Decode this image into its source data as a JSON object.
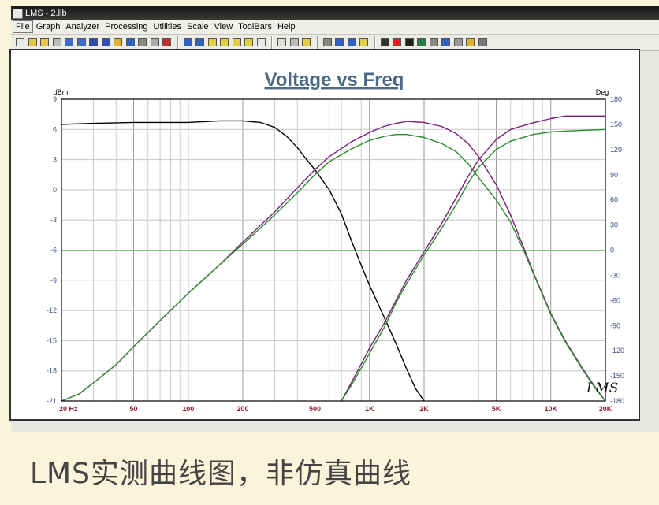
{
  "window": {
    "title": "LMS - 2.lib"
  },
  "menu": [
    "File",
    "Graph",
    "Analyzer",
    "Processing",
    "Utilities",
    "Scale",
    "View",
    "ToolBars",
    "Help"
  ],
  "toolbar": {
    "icons": [
      {
        "name": "new-icon",
        "color": "#e8e8e8"
      },
      {
        "name": "open-icon",
        "color": "#e8c54a"
      },
      {
        "name": "open-folder-icon",
        "color": "#e8c54a"
      },
      {
        "name": "save-gray-icon",
        "color": "#bbbbbb"
      },
      {
        "name": "save-icon",
        "color": "#3a6fd0"
      },
      {
        "name": "import-icon",
        "color": "#3a6fd0"
      },
      {
        "name": "export-icon",
        "color": "#2e4fb0"
      },
      {
        "name": "library-icon",
        "color": "#2e4fb0"
      },
      {
        "name": "folder-icon",
        "color": "#e0b030"
      },
      {
        "name": "disk-icon",
        "color": "#3060c0"
      },
      {
        "name": "print-icon",
        "color": "#888888"
      },
      {
        "name": "edit-icon",
        "color": "#aaaaaa"
      },
      {
        "name": "clear-icon",
        "color": "#c03030"
      },
      {
        "name": "zoom-in-icon",
        "color": "#3060c0"
      },
      {
        "name": "zoom-out-icon",
        "color": "#3060c0"
      },
      {
        "name": "graph-a-icon",
        "color": "#e0d040"
      },
      {
        "name": "graph-b-icon",
        "color": "#e0d040"
      },
      {
        "name": "graph-c-icon",
        "color": "#e0d040"
      },
      {
        "name": "graph-d-icon",
        "color": "#e0d040"
      },
      {
        "name": "grid-icon",
        "color": "#e8e8e8"
      },
      {
        "name": "window-icon",
        "color": "#dddddd"
      },
      {
        "name": "panel-icon",
        "color": "#bbbbbb"
      },
      {
        "name": "help-icon",
        "color": "#e0d040"
      },
      {
        "name": "cursor-icon",
        "color": "#888888"
      },
      {
        "name": "marker-a-icon",
        "color": "#3060c0"
      },
      {
        "name": "marker-b-icon",
        "color": "#3060c0"
      },
      {
        "name": "marker-c-icon",
        "color": "#e0d040"
      },
      {
        "name": "chip-icon",
        "color": "#333333"
      },
      {
        "name": "record-icon",
        "color": "#e02020"
      },
      {
        "name": "stop-icon",
        "color": "#222222"
      },
      {
        "name": "meter-icon",
        "color": "#208040"
      },
      {
        "name": "probe-icon",
        "color": "#888888"
      },
      {
        "name": "wand-icon",
        "color": "#3060c0"
      },
      {
        "name": "tweezers-icon",
        "color": "#999999"
      },
      {
        "name": "gear-icon",
        "color": "#e0b030"
      },
      {
        "name": "speaker-icon",
        "color": "#777777"
      }
    ]
  },
  "chart_data": {
    "type": "line",
    "title": "Voltage vs Freq",
    "x_scale": "log",
    "xlim": [
      20,
      20000
    ],
    "x_ticks": [
      {
        "value": 20,
        "label": "20  Hz"
      },
      {
        "value": 50,
        "label": "50"
      },
      {
        "value": 100,
        "label": "100"
      },
      {
        "value": 200,
        "label": "200"
      },
      {
        "value": 500,
        "label": "500"
      },
      {
        "value": 1000,
        "label": "1K"
      },
      {
        "value": 2000,
        "label": "2K"
      },
      {
        "value": 5000,
        "label": "5K"
      },
      {
        "value": 10000,
        "label": "10K"
      },
      {
        "value": 20000,
        "label": "20K"
      }
    ],
    "y_left": {
      "unit": "dBm",
      "ylim": [
        -21,
        9
      ],
      "ticks": [
        9,
        6,
        3,
        0,
        -3,
        -6,
        -9,
        -12,
        -15,
        -18,
        -21
      ]
    },
    "y_right": {
      "unit": "Deg",
      "ylim": [
        -180,
        180
      ],
      "ticks": [
        180,
        150,
        120,
        90,
        60,
        30,
        0,
        -30,
        -60,
        -90,
        -120,
        -150,
        -180
      ]
    },
    "reference_line": {
      "axis": "left",
      "value": -6,
      "color": "#7ec77e"
    },
    "grid": true,
    "series": [
      {
        "axis": "left",
        "color": "#000000",
        "x": [
          20,
          30,
          50,
          100,
          150,
          200,
          250,
          300,
          350,
          400,
          450,
          500,
          600,
          700,
          800,
          900,
          1000,
          1200,
          1400,
          1600,
          1800,
          2000
        ],
        "y": [
          6.5,
          6.6,
          6.7,
          6.7,
          6.85,
          6.85,
          6.7,
          6.2,
          5.3,
          4.2,
          3.0,
          2.0,
          0.0,
          -2.4,
          -5.2,
          -7.5,
          -9.5,
          -12.6,
          -15.3,
          -17.8,
          -19.8,
          -21
        ]
      },
      {
        "axis": "left",
        "color": "#7a1f7a",
        "x": [
          20,
          25,
          30,
          40,
          50,
          70,
          100,
          150,
          200,
          300,
          400,
          500,
          600,
          800,
          1000,
          1200,
          1400,
          1600,
          2000,
          2500,
          3000,
          3500,
          4000,
          5000,
          6000,
          7000,
          8000,
          10000,
          12000,
          15000,
          18000,
          20000
        ],
        "y": [
          -21,
          -20.3,
          -19.2,
          -17.4,
          -15.6,
          -13.0,
          -10.3,
          -7.4,
          -5.2,
          -2.2,
          0.2,
          2.0,
          3.3,
          4.8,
          5.7,
          6.3,
          6.6,
          6.8,
          6.7,
          6.3,
          5.6,
          4.6,
          3.3,
          0.5,
          -2.5,
          -5.5,
          -8.2,
          -12.3,
          -15.0,
          -17.8,
          -19.9,
          -21
        ]
      },
      {
        "axis": "left",
        "color": "#2e8b2e",
        "x": [
          20,
          25,
          30,
          40,
          50,
          70,
          100,
          150,
          200,
          300,
          400,
          500,
          600,
          800,
          1000,
          1200,
          1400,
          1600,
          2000,
          2500,
          3000,
          3500,
          4000,
          5000,
          6000,
          7000,
          8000,
          10000,
          12000,
          15000,
          18000,
          20000
        ],
        "y": [
          -21,
          -20.3,
          -19.2,
          -17.4,
          -15.6,
          -13.0,
          -10.3,
          -7.4,
          -5.4,
          -2.5,
          -0.3,
          1.5,
          2.8,
          4.1,
          4.9,
          5.3,
          5.5,
          5.5,
          5.2,
          4.6,
          3.8,
          2.6,
          1.2,
          -1.0,
          -3.2,
          -5.8,
          -8.3,
          -12.4,
          -15.1,
          -17.9,
          -20.0,
          -21
        ]
      },
      {
        "axis": "right",
        "color": "#7a1f7a",
        "x": [
          700,
          800,
          900,
          1000,
          1200,
          1400,
          1600,
          2000,
          2500,
          3000,
          3500,
          4000,
          5000,
          6000,
          8000,
          10000,
          12000,
          15000,
          20000
        ],
        "y": [
          -180,
          -157,
          -136,
          -117,
          -88,
          -60,
          -36,
          -2,
          32,
          62,
          88,
          108,
          132,
          144,
          152,
          157,
          160,
          160,
          160
        ]
      },
      {
        "axis": "right",
        "color": "#2e8b2e",
        "x": [
          700,
          800,
          900,
          1000,
          1200,
          1400,
          1600,
          2000,
          2500,
          3000,
          3500,
          4000,
          5000,
          6000,
          8000,
          10000,
          12000,
          15000,
          20000
        ],
        "y": [
          -180,
          -160,
          -141,
          -123,
          -93,
          -63,
          -40,
          -6,
          26,
          54,
          80,
          99,
          120,
          130,
          138,
          141,
          142,
          143,
          144
        ]
      }
    ]
  },
  "watermark": "LMS",
  "caption": "LMS实测曲线图，非仿真曲线"
}
